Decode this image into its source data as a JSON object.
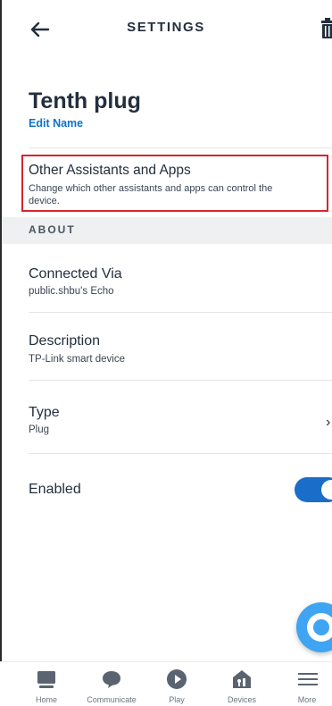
{
  "header": {
    "title": "SETTINGS"
  },
  "device": {
    "name": "Tenth plug",
    "edit_label": "Edit Name"
  },
  "assistants": {
    "title": "Other Assistants and Apps",
    "subtitle_line1": "Change which other assistants and apps can control the",
    "subtitle_line2": "device."
  },
  "about": {
    "section_label": "ABOUT",
    "connected": {
      "title": "Connected Via",
      "value": "public.shbu's Echo"
    },
    "description": {
      "title": "Description",
      "value": "TP-Link smart device"
    },
    "type": {
      "title": "Type",
      "value": "Plug",
      "chevron": "›"
    }
  },
  "enabled": {
    "label": "Enabled",
    "state": "on"
  },
  "nav": {
    "items": [
      {
        "label": "Home",
        "icon": "home-icon"
      },
      {
        "label": "Communicate",
        "icon": "chat-bubble-icon"
      },
      {
        "label": "Play",
        "icon": "play-icon"
      },
      {
        "label": "Devices",
        "icon": "devices-house-icon"
      },
      {
        "label": "More",
        "icon": "menu-icon"
      }
    ]
  },
  "colors": {
    "accent": "#1a6ec9",
    "link": "#0d73c8",
    "highlight_border": "#d4262e",
    "fab": "#3fa4f2"
  }
}
